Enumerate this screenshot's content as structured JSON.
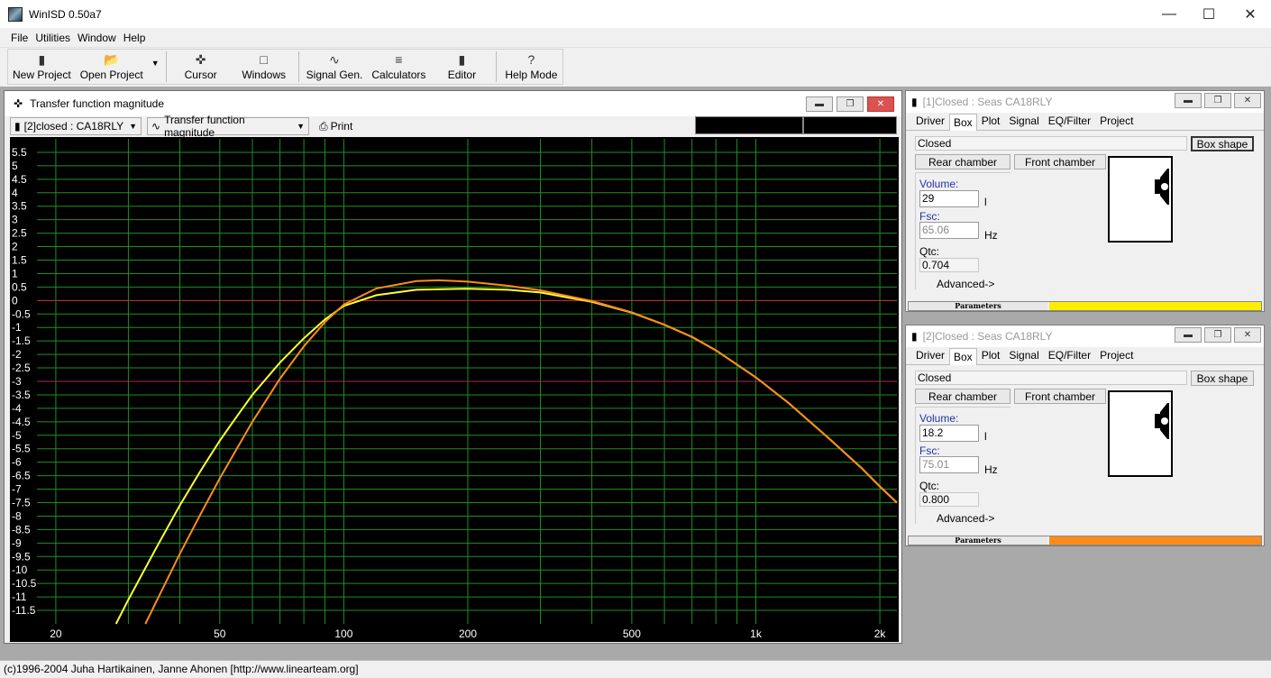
{
  "app": {
    "title": "WinISD 0.50a7"
  },
  "menu": {
    "file": "File",
    "utilities": "Utilities",
    "window": "Window",
    "help": "Help"
  },
  "toolbar": {
    "new_project": "New Project",
    "open_project": "Open Project",
    "cursor": "Cursor",
    "windows": "Windows",
    "signal_gen": "Signal Gen.",
    "calculators": "Calculators",
    "editor": "Editor",
    "help_mode": "Help Mode"
  },
  "tf_window": {
    "title": "Transfer function magnitude",
    "project_select": "[2]closed : CA18RLY",
    "graph_select": "Transfer function magnitude",
    "print": "Print"
  },
  "chart_data": {
    "type": "line",
    "x_scale": "log",
    "xlim": [
      18,
      2200
    ],
    "ylim": [
      -12,
      6
    ],
    "x_ticks": [
      {
        "v": 20,
        "label": "20"
      },
      {
        "v": 50,
        "label": "50"
      },
      {
        "v": 100,
        "label": "100"
      },
      {
        "v": 200,
        "label": "200"
      },
      {
        "v": 500,
        "label": "500"
      },
      {
        "v": 1000,
        "label": "1k"
      },
      {
        "v": 2000,
        "label": "2k"
      }
    ],
    "y_ticks": [
      "5.5",
      "5",
      "4.5",
      "4",
      "3.5",
      "3",
      "2.5",
      "2",
      "1.5",
      "1",
      "0.5",
      "0",
      "-0.5",
      "-1",
      "-1.5",
      "-2",
      "-2.5",
      "-3",
      "-3.5",
      "-4",
      "-4.5",
      "-5",
      "-5.5",
      "-6",
      "-6.5",
      "-7",
      "-7.5",
      "-8",
      "-8.5",
      "-9",
      "-9.5",
      "-10",
      "-10.5",
      "-11",
      "-11.5"
    ],
    "y_tick_values": [
      5.5,
      5,
      4.5,
      4,
      3.5,
      3,
      2.5,
      2,
      1.5,
      1,
      0.5,
      0,
      -0.5,
      -1,
      -1.5,
      -2,
      -2.5,
      -3,
      -3.5,
      -4,
      -4.5,
      -5,
      -5.5,
      -6,
      -6.5,
      -7,
      -7.5,
      -8,
      -8.5,
      -9,
      -9.5,
      -10,
      -10.5,
      -11,
      -11.5
    ],
    "grid": true,
    "reference_lines": [
      {
        "y": 0,
        "color": "#cc2222"
      },
      {
        "y": -3,
        "color": "#aa2266"
      }
    ],
    "series": [
      {
        "color": "#ffff33",
        "x": [
          28,
          30,
          35,
          40,
          45,
          50,
          55,
          60,
          70,
          80,
          90,
          100,
          120,
          150,
          200,
          250,
          300,
          400,
          500,
          600,
          700,
          800,
          1000,
          1200,
          1500,
          1800,
          2000,
          2200
        ],
        "y": [
          -12,
          -11.1,
          -9.2,
          -7.6,
          -6.3,
          -5.2,
          -4.3,
          -3.5,
          -2.3,
          -1.4,
          -0.7,
          -0.2,
          0.2,
          0.4,
          0.44,
          0.4,
          0.3,
          -0.05,
          -0.45,
          -0.9,
          -1.35,
          -1.85,
          -2.85,
          -3.8,
          -5.1,
          -6.2,
          -6.9,
          -7.5
        ]
      },
      {
        "color": "#ff8c1a",
        "x": [
          33,
          35,
          40,
          45,
          50,
          55,
          60,
          70,
          80,
          90,
          100,
          120,
          150,
          170,
          200,
          250,
          300,
          400,
          500,
          600,
          700,
          800,
          1000,
          1200,
          1500,
          1800,
          2000,
          2200
        ],
        "y": [
          -12,
          -11.2,
          -9.4,
          -7.9,
          -6.6,
          -5.5,
          -4.5,
          -2.9,
          -1.7,
          -0.8,
          -0.15,
          0.45,
          0.72,
          0.75,
          0.7,
          0.55,
          0.38,
          -0.02,
          -0.44,
          -0.9,
          -1.35,
          -1.85,
          -2.85,
          -3.8,
          -5.1,
          -6.2,
          -6.9,
          -7.5
        ]
      }
    ]
  },
  "param_win_1": {
    "title": "[1]Closed : Seas CA18RLY",
    "tabs": [
      "Driver",
      "Box",
      "Plot",
      "Signal",
      "EQ/Filter",
      "Project"
    ],
    "box_type": "Closed",
    "box_shape_btn": "Box shape",
    "rear_chamber_btn": "Rear chamber",
    "front_chamber_btn": "Front chamber",
    "volume_label": "Volume:",
    "volume": "29",
    "volume_unit": "l",
    "fsc_label": "Fsc:",
    "fsc": "65.06",
    "fsc_unit": "Hz",
    "qtc_label": "Qtc:",
    "qtc": "0.704",
    "advanced": "Advanced->",
    "parameters": "Parameters",
    "series_color": "#ffee00"
  },
  "param_win_2": {
    "title": "[2]Closed : Seas CA18RLY",
    "tabs": [
      "Driver",
      "Box",
      "Plot",
      "Signal",
      "EQ/Filter",
      "Project"
    ],
    "box_type": "Closed",
    "box_shape_btn": "Box shape",
    "rear_chamber_btn": "Rear chamber",
    "front_chamber_btn": "Front chamber",
    "volume_label": "Volume:",
    "volume": "18.2",
    "volume_unit": "l",
    "fsc_label": "Fsc:",
    "fsc": "75.01",
    "fsc_unit": "Hz",
    "qtc_label": "Qtc:",
    "qtc": "0.800",
    "advanced": "Advanced->",
    "parameters": "Parameters",
    "series_color": "#ff8c1a"
  },
  "statusbar": {
    "text": "(c)1996-2004 Juha Hartikainen, Janne Ahonen [http://www.linearteam.org]"
  }
}
